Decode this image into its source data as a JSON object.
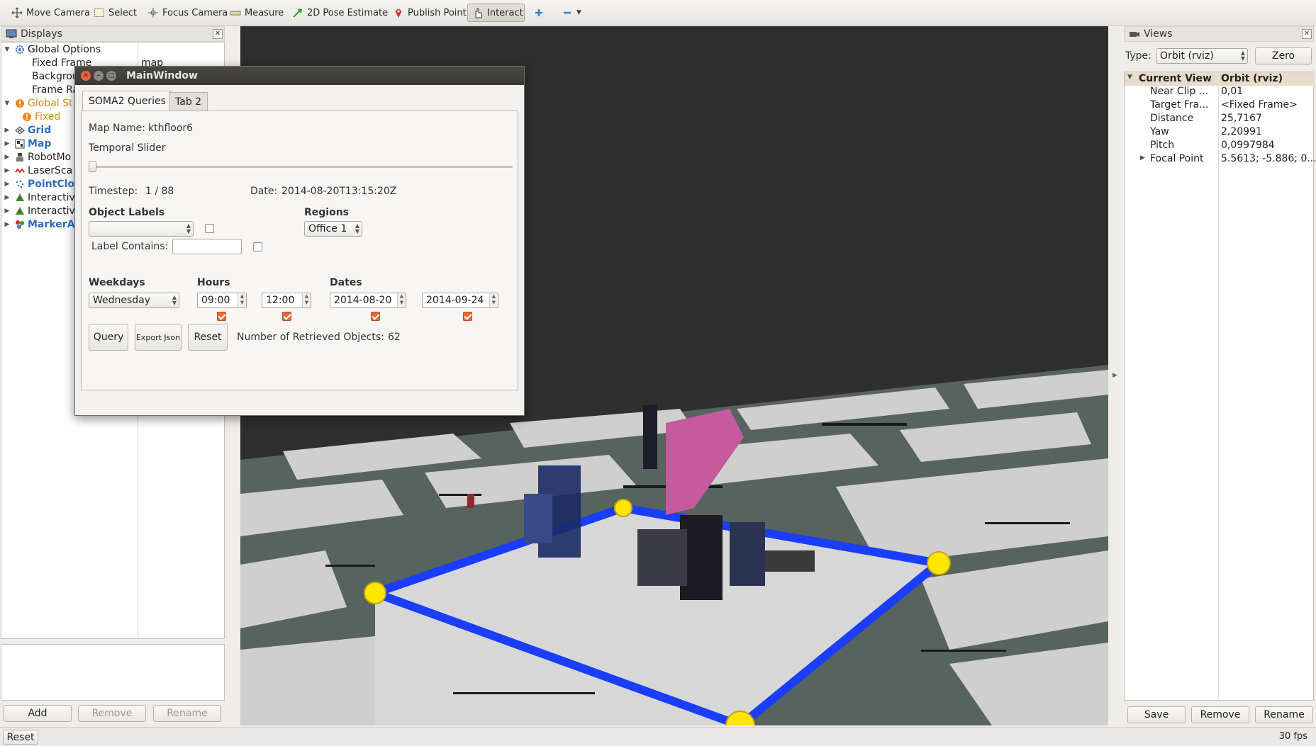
{
  "toolbar": {
    "move_camera": "Move Camera",
    "select": "Select",
    "focus_camera": "Focus Camera",
    "measure": "Measure",
    "pose_estimate": "2D Pose Estimate",
    "publish_point": "Publish Point",
    "interact": "Interact"
  },
  "displays": {
    "title": "Displays",
    "items": [
      {
        "label": "Global Options",
        "value": ""
      },
      {
        "label": "Fixed Frame",
        "value": "map"
      },
      {
        "label": "Backgrou",
        "value": ""
      },
      {
        "label": "Frame Ra",
        "value": ""
      },
      {
        "label": "Global St",
        "value": ""
      },
      {
        "label": "Fixed",
        "value": ""
      },
      {
        "label": "Grid",
        "value": ""
      },
      {
        "label": "Map",
        "value": ""
      },
      {
        "label": "RobotMo",
        "value": ""
      },
      {
        "label": "LaserSca",
        "value": ""
      },
      {
        "label": "PointClo",
        "value": ""
      },
      {
        "label": "Interactiv",
        "value": ""
      },
      {
        "label": "Interactiv",
        "value": ""
      },
      {
        "label": "MarkerA",
        "value": ""
      }
    ],
    "add_label": "Add",
    "remove_label": "Remove",
    "rename_label": "Rename"
  },
  "mainwindow": {
    "title": "MainWindow",
    "tabs": [
      "SOMA2 Queries",
      "Tab 2"
    ],
    "map_name_label": "Map Name:",
    "map_name_value": "kthfloor6",
    "temporal_slider_label": "Temporal Slider",
    "slider_value": 0,
    "timestep_label": "Timestep:",
    "timestep_value": "1 / 88",
    "date_label": "Date:",
    "date_value": "2014-08-20T13:15:20Z",
    "object_labels_header": "Object Labels",
    "object_labels_value": "",
    "object_labels_checked": false,
    "regions_header": "Regions",
    "regions_value": "Office 1",
    "label_contains_label": "Label Contains:",
    "label_contains_value": "",
    "label_contains_checked": false,
    "weekdays_header": "Weekdays",
    "weekday_value": "Wednesday",
    "hours_header": "Hours",
    "hour_start": "09:00",
    "hour_end": "12:00",
    "dates_header": "Dates",
    "date_start": "2014-08-20",
    "date_end": "2014-09-24",
    "query_label": "Query",
    "export_label": "Export Json",
    "reset_label": "Reset",
    "retrieved_label": "Number of Retrieved Objects:",
    "retrieved_value": "62"
  },
  "views": {
    "title": "Views",
    "type_label": "Type:",
    "type_value": "Orbit (rviz)",
    "zero_label": "Zero",
    "current_view_label": "Current View",
    "current_view_value": "Orbit (rviz)",
    "props": [
      {
        "name": "Near Clip ...",
        "value": "0,01"
      },
      {
        "name": "Target Fra...",
        "value": "<Fixed Frame>"
      },
      {
        "name": "Distance",
        "value": "25,7167"
      },
      {
        "name": "Yaw",
        "value": "2,20991"
      },
      {
        "name": "Pitch",
        "value": "0,0997984"
      },
      {
        "name": "Focal Point",
        "value": "5.5613; -5.886; 0...."
      }
    ],
    "save_label": "Save",
    "remove_label": "Remove",
    "rename_label": "Rename"
  },
  "status": {
    "reset_label": "Reset",
    "fps": "30 fps"
  },
  "colors": {
    "region_outline": "#1a3dff",
    "region_handle": "#ffe600",
    "accent_check": "#e06d3a",
    "tree_link": "#2e6ec0"
  }
}
